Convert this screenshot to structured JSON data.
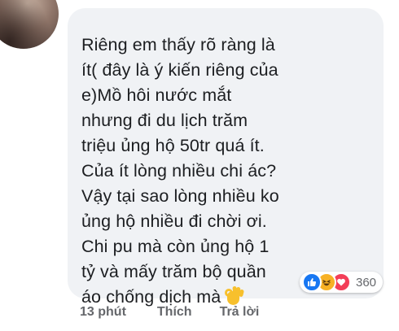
{
  "comment": {
    "lines": [
      "Riêng em thấy rõ ràng là",
      "ít( đây là ý kiến riêng của",
      "e)Mồ hôi nước mắt",
      "nhưng đi du lịch trăm",
      "triệu ủng hộ 50tr quá ít.",
      "Của ít lòng nhiều chi ác?",
      "Vậy tại sao lòng nhiều ko",
      "ủng hộ nhiều đi chời ơi.",
      "Chi pu mà còn ủng hộ 1",
      "tỷ và mấy trăm bộ quần",
      "áo chống dịch mà"
    ],
    "trailing_emoji": "ok-hand-emoji"
  },
  "reactions": {
    "icons": [
      "like-icon",
      "haha-icon",
      "love-icon"
    ],
    "count": "360",
    "colors": {
      "like": "#1877f2",
      "haha": "#f7b125",
      "love": "#f33e58"
    }
  },
  "actions": {
    "time": "13 phút",
    "like_label": "Thích",
    "reply_label": "Trả lời"
  },
  "colors": {
    "bubble_bg": "#f0f2f5",
    "text": "#1c1e21",
    "meta": "#65676b"
  }
}
